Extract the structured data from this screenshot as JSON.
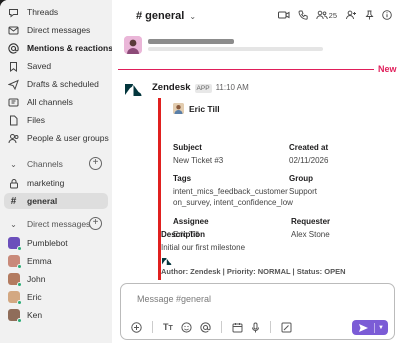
{
  "sidebar": {
    "items": [
      {
        "label": "Threads",
        "icon": "threads-icon"
      },
      {
        "label": "Direct messages",
        "icon": "direct-messages-icon"
      },
      {
        "label": "Mentions & reactions",
        "icon": "at-mention-icon"
      },
      {
        "label": "Saved",
        "icon": "bookmark-icon"
      },
      {
        "label": "Drafts & scheduled",
        "icon": "send-icon"
      },
      {
        "label": "All channels",
        "icon": "channels-icon"
      },
      {
        "label": "Files",
        "icon": "files-icon"
      },
      {
        "label": "People & user groups",
        "icon": "people-icon"
      }
    ],
    "channels_header": "Channels",
    "channels": [
      {
        "label": "marketing",
        "icon": "lock-icon"
      },
      {
        "label": "general",
        "icon": "hash-icon"
      }
    ],
    "dm_header": "Direct messages",
    "dms": [
      {
        "label": "Pumblebot"
      },
      {
        "label": "Emma"
      },
      {
        "label": "John"
      },
      {
        "label": "Eric"
      },
      {
        "label": "Ken"
      }
    ]
  },
  "header": {
    "channel_name": "# general",
    "member_count": "25"
  },
  "divider": {
    "new_label": "New"
  },
  "message": {
    "sender": "Zendesk",
    "badge": "APP",
    "time": "11:10 AM",
    "card": {
      "author": "Eric Till",
      "subject_label": "Subject",
      "subject_value": "New Ticket #3",
      "created_label": "Created at",
      "created_value": "02/11/2026",
      "tags_label": "Tags",
      "tags_line1": "intent_mics_feedback_customer",
      "tags_line2": "on_survey, intent_confidence_low",
      "group_label": "Group",
      "group_value": "Support",
      "assignee_label": "Assignee",
      "assignee_value": "Eric Till",
      "requester_label": "Requester",
      "requester_value": "Alex Stone",
      "description_label": "Description",
      "description_value": "Initial our first milestone",
      "footer": "Author: Zendesk | Priority: NORMAL | Status: OPEN"
    }
  },
  "composer": {
    "placeholder": "Message #general"
  },
  "colors": {
    "accent": "#e01e5a",
    "card_border": "#e0201f",
    "send": "#7b5cd6",
    "online": "#2bac76"
  }
}
